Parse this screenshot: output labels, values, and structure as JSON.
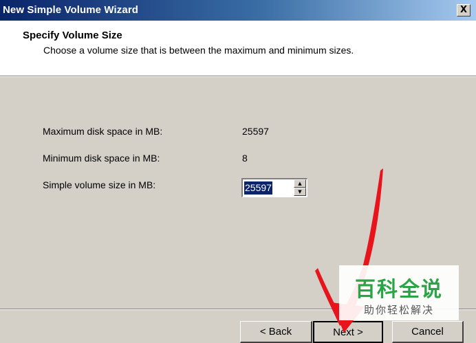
{
  "window": {
    "title": "New Simple Volume Wizard",
    "close_glyph": "X"
  },
  "header": {
    "title": "Specify Volume Size",
    "subtitle": "Choose a volume size that is between the maximum and minimum sizes."
  },
  "fields": {
    "max_label": "Maximum disk space in MB:",
    "max_value": "25597",
    "min_label": "Minimum disk space in MB:",
    "min_value": "8",
    "size_label": "Simple volume size in MB:",
    "size_value": "25597"
  },
  "buttons": {
    "back": "< Back",
    "next": "Next >",
    "cancel": "Cancel"
  },
  "watermark": {
    "main": "百科全说",
    "sub": "助你轻松解决"
  },
  "colors": {
    "titlebar_start": "#0a246a",
    "titlebar_end": "#a6caf0",
    "dialog_bg": "#d4d0c8",
    "annotation_arrow": "#e8141c",
    "watermark_green": "#2aa444"
  },
  "icons": {
    "spin_up": "up-arrow-icon",
    "spin_down": "down-arrow-icon",
    "close": "close-icon"
  }
}
